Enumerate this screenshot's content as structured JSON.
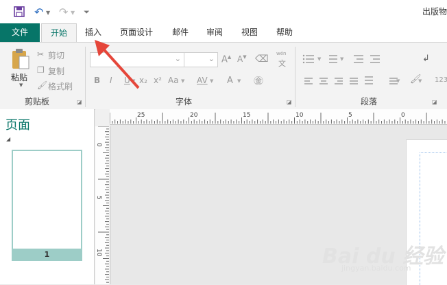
{
  "titlebar": {
    "app_title": "出版物",
    "icons": [
      "save-icon",
      "undo-icon",
      "redo-icon",
      "customize-qat-icon"
    ]
  },
  "tabs": [
    {
      "label": "文件"
    },
    {
      "label": "开始"
    },
    {
      "label": "插入"
    },
    {
      "label": "页面设计"
    },
    {
      "label": "邮件"
    },
    {
      "label": "审阅"
    },
    {
      "label": "视图"
    },
    {
      "label": "帮助"
    }
  ],
  "ribbon": {
    "clipboard": {
      "group_label": "剪贴板",
      "paste": "粘贴",
      "cut": "剪切",
      "copy": "复制",
      "format_painter": "格式刷"
    },
    "font": {
      "group_label": "字体",
      "font_name": "",
      "font_size": "",
      "pinyin": "wén",
      "pinyin_char": "文",
      "bold": "B",
      "italic": "I",
      "underline": "U",
      "subscript": "x₂",
      "superscript": "x²",
      "change_case": "Aa",
      "spacing": "AV",
      "font_color": "A"
    },
    "paragraph": {
      "group_label": "段落"
    },
    "overflow_label": "123"
  },
  "pages_pane": {
    "title": "页面",
    "pages": [
      {
        "number": "1"
      }
    ]
  },
  "rulers": {
    "horizontal_labels": [
      "25",
      "20",
      "15",
      "10",
      "5",
      "0"
    ],
    "vertical_labels": [
      "0",
      "5",
      "10"
    ]
  },
  "watermark": {
    "text": "Bai du 经验",
    "sub": "jingyan.baidu.com"
  },
  "colors": {
    "accent": "#077568",
    "thumb_highlight": "#9dcdc7",
    "arrow": "#e5463a"
  }
}
